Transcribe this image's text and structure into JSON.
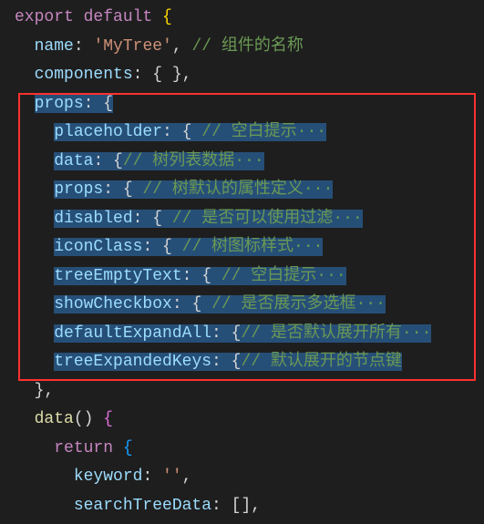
{
  "code": {
    "l1_export": "export",
    "l1_default": "default",
    "l1_brace": " {",
    "l2_key": "name",
    "l2_colon": ": ",
    "l2_val": "'MyTree'",
    "l2_comma": ",",
    "l2_comment": " // 组件的名称",
    "l3_key": "components",
    "l3_rest": ": { },",
    "l4_key": "props",
    "l4_rest": ": {",
    "l5_key": "placeholder",
    "l5_rest": ": { ",
    "l5_comment": "// 空白提示···",
    "l6_key": "data",
    "l6_rest": ": {",
    "l6_comment": "// 树列表数据···",
    "l7_key": "props",
    "l7_rest": ": { ",
    "l7_comment": "// 树默认的属性定义···",
    "l8_key": "disabled",
    "l8_rest": ": { ",
    "l8_comment": "// 是否可以使用过滤···",
    "l9_key": "iconClass",
    "l9_rest": ": { ",
    "l9_comment": "// 树图标样式···",
    "l10_key": "treeEmptyText",
    "l10_rest": ": { ",
    "l10_comment": "// 空白提示···",
    "l11_key": "showCheckbox",
    "l11_rest": ": { ",
    "l11_comment": "// 是否展示多选框···",
    "l12_key": "defaultExpandAll",
    "l12_rest": ": {",
    "l12_comment": "// 是否默认展开所有···",
    "l13_key": "treeExpandedKeys",
    "l13_rest": ": {",
    "l13_comment": "// 默认展开的节点键",
    "l14": "},",
    "l15_fn": "data",
    "l15_rest": "() ",
    "l15_brace": "{",
    "l16_return": "return",
    "l16_brace": " {",
    "l17_key": "keyword",
    "l17_rest": ": ",
    "l17_val": "''",
    "l17_comma": ",",
    "l18_key": "searchTreeData",
    "l18_rest": ": [],"
  }
}
